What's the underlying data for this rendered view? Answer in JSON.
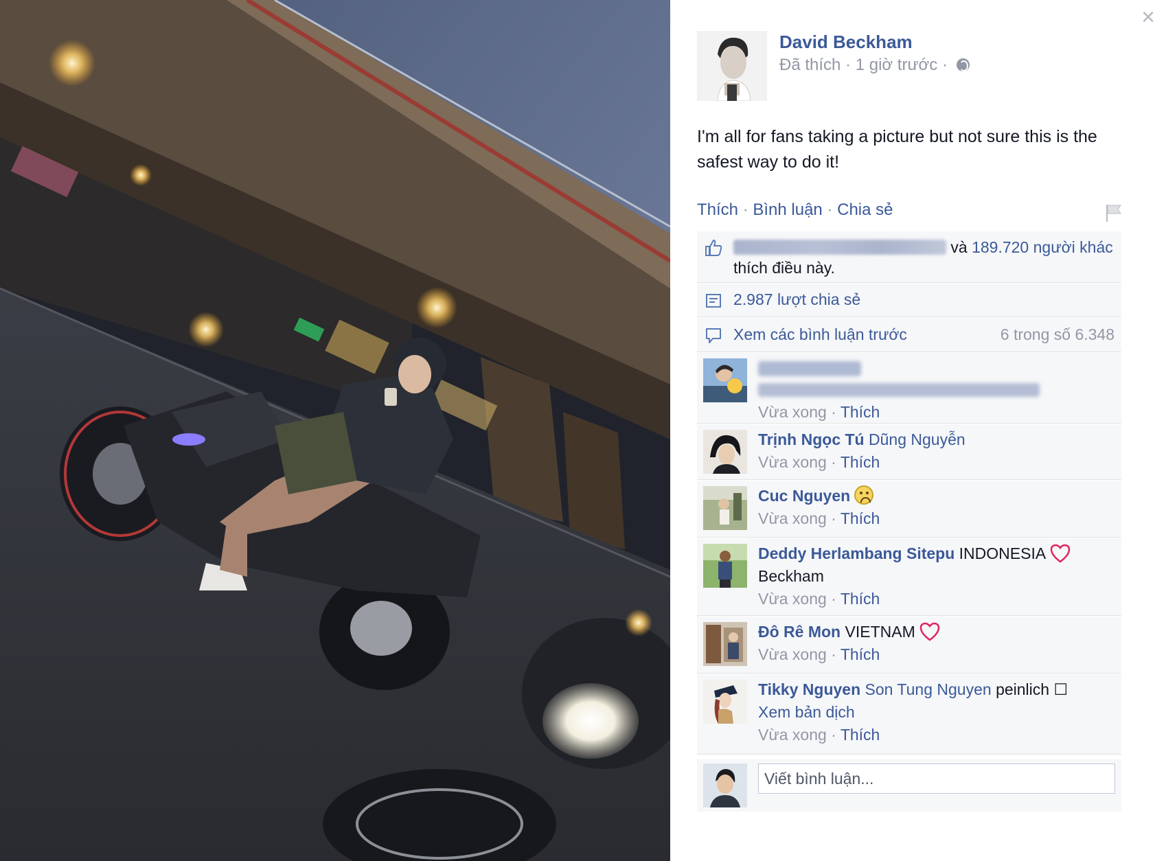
{
  "dialog": {
    "close_label": "×"
  },
  "photo": {
    "description_icon": "photo"
  },
  "post": {
    "author": "David Beckham",
    "meta_prefix": "Đã thích · 1 giờ trước · ",
    "text": "I'm all for fans taking a picture but not sure this is the safest way to do it!"
  },
  "actions": {
    "like": "Thích",
    "comment": "Bình luận",
    "share": "Chia sẻ",
    "separator": " · "
  },
  "likes": {
    "connector": " và ",
    "others": "189.720 người khác",
    "suffix": "thích điều này."
  },
  "shares": {
    "label": "2.987 lượt chia sẻ"
  },
  "previous": {
    "label": "Xem các bình luận trước",
    "count": "6 trong số 6.348"
  },
  "comments": [
    {
      "meta": "Vừa xong · ",
      "like": "Thích"
    },
    {
      "name": "Trịnh Ngọc Tú",
      "tag": "Dũng Nguyễn",
      "meta": "Vừa xong · ",
      "like": "Thích"
    },
    {
      "name": "Cuc Nguyen",
      "meta": "Vừa xong · ",
      "like": "Thích"
    },
    {
      "name": "Deddy Herlambang Sitepu",
      "text": "INDONESIA",
      "text2": "Beckham",
      "meta": "Vừa xong · ",
      "like": "Thích"
    },
    {
      "name": "Đô Rê Mon",
      "text": "VIETNAM",
      "meta": "Vừa xong · ",
      "like": "Thích"
    },
    {
      "name": "Tikky Nguyen",
      "tag": "Son Tung Nguyen",
      "text": "peinlich ☐",
      "translate": "Xem bản dịch",
      "meta": "Vừa xong · ",
      "like": "Thích"
    }
  ],
  "compose": {
    "placeholder": "Viết bình luận..."
  },
  "colors": {
    "link": "#3b5998",
    "meta": "#9197a3",
    "panel_row": "#f6f7f9",
    "heart": "#e0245e"
  }
}
